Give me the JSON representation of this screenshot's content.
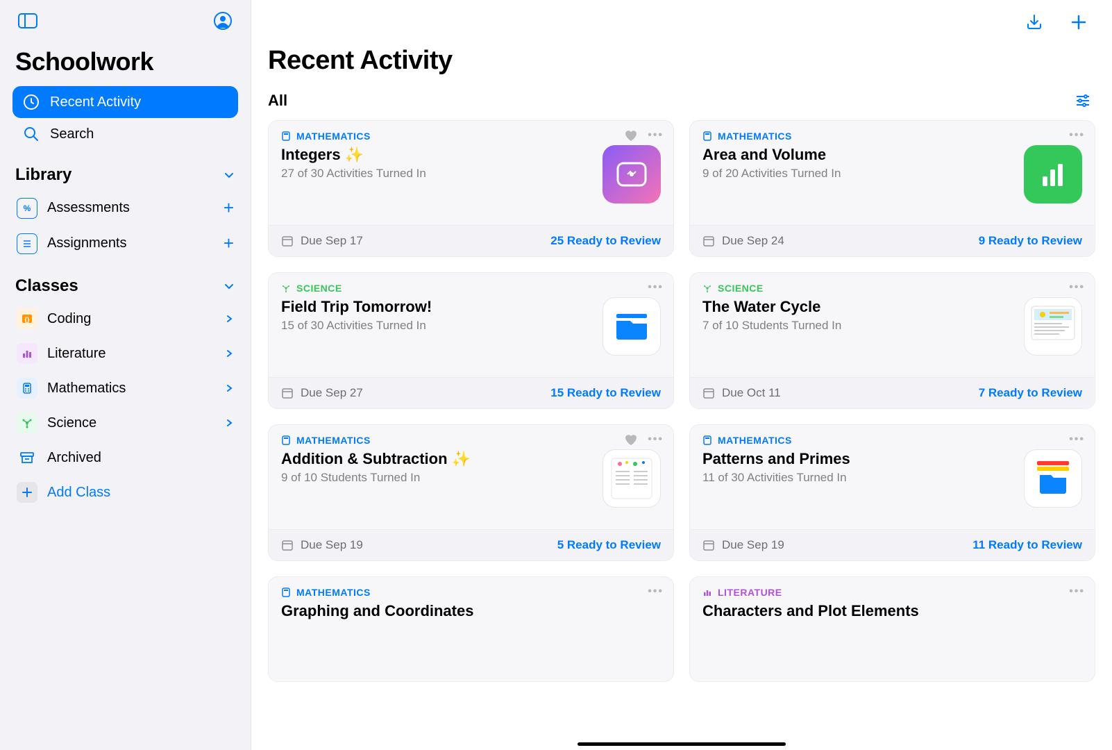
{
  "app_title": "Schoolwork",
  "sidebar": {
    "nav": [
      {
        "label": "Recent Activity",
        "icon": "clock",
        "active": true
      },
      {
        "label": "Search",
        "icon": "search",
        "active": false
      }
    ],
    "library": {
      "header": "Library",
      "items": [
        {
          "label": "Assessments",
          "icon": "percent"
        },
        {
          "label": "Assignments",
          "icon": "doc"
        }
      ]
    },
    "classes": {
      "header": "Classes",
      "items": [
        {
          "label": "Coding",
          "icon": "code",
          "color": "#ff9500"
        },
        {
          "label": "Literature",
          "icon": "bars",
          "color": "#af52de"
        },
        {
          "label": "Mathematics",
          "icon": "calc",
          "color": "#007aff"
        },
        {
          "label": "Science",
          "icon": "atom",
          "color": "#34c759"
        },
        {
          "label": "Archived",
          "icon": "archive",
          "color": "#007aff",
          "noChevron": true
        }
      ],
      "add_label": "Add Class"
    }
  },
  "main": {
    "title": "Recent Activity",
    "filter": "All",
    "cards": [
      {
        "subject": "MATHEMATICS",
        "subjectClass": "subject-math",
        "title": "Integers ✨",
        "sub": "27 of 30 Activities Turned In",
        "due": "Due Sep 17",
        "review": "25 Ready to Review",
        "heart": true,
        "thumb": "gradient"
      },
      {
        "subject": "MATHEMATICS",
        "subjectClass": "subject-math",
        "title": "Area and Volume",
        "sub": "9 of 20 Activities Turned In",
        "due": "Due Sep 24",
        "review": "9 Ready to Review",
        "heart": false,
        "thumb": "green"
      },
      {
        "subject": "SCIENCE",
        "subjectClass": "subject-science",
        "title": "Field Trip Tomorrow!",
        "sub": "15 of 30 Activities Turned In",
        "due": "Due Sep 27",
        "review": "15 Ready to Review",
        "heart": false,
        "thumb": "bluefolder"
      },
      {
        "subject": "SCIENCE",
        "subjectClass": "subject-science",
        "title": "The Water Cycle",
        "sub": "7 of 10 Students Turned In",
        "due": "Due Oct 11",
        "review": "7 Ready to Review",
        "heart": false,
        "thumb": "doc"
      },
      {
        "subject": "MATHEMATICS",
        "subjectClass": "subject-math",
        "title": "Addition & Subtraction ✨",
        "sub": "9 of 10 Students Turned In",
        "due": "Due Sep 19",
        "review": "5 Ready to Review",
        "heart": true,
        "thumb": "doc2"
      },
      {
        "subject": "MATHEMATICS",
        "subjectClass": "subject-math",
        "title": "Patterns and Primes",
        "sub": "11 of 30 Activities Turned In",
        "due": "Due Sep 19",
        "review": "11 Ready to Review",
        "heart": false,
        "thumb": "bluefolder2"
      },
      {
        "subject": "MATHEMATICS",
        "subjectClass": "subject-math",
        "title": "Graphing and Coordinates",
        "sub": "",
        "due": "",
        "review": "",
        "heart": false,
        "thumb": "none"
      },
      {
        "subject": "LITERATURE",
        "subjectClass": "subject-literature",
        "title": "Characters and Plot Elements",
        "sub": "",
        "due": "",
        "review": "",
        "heart": false,
        "thumb": "none"
      }
    ]
  }
}
